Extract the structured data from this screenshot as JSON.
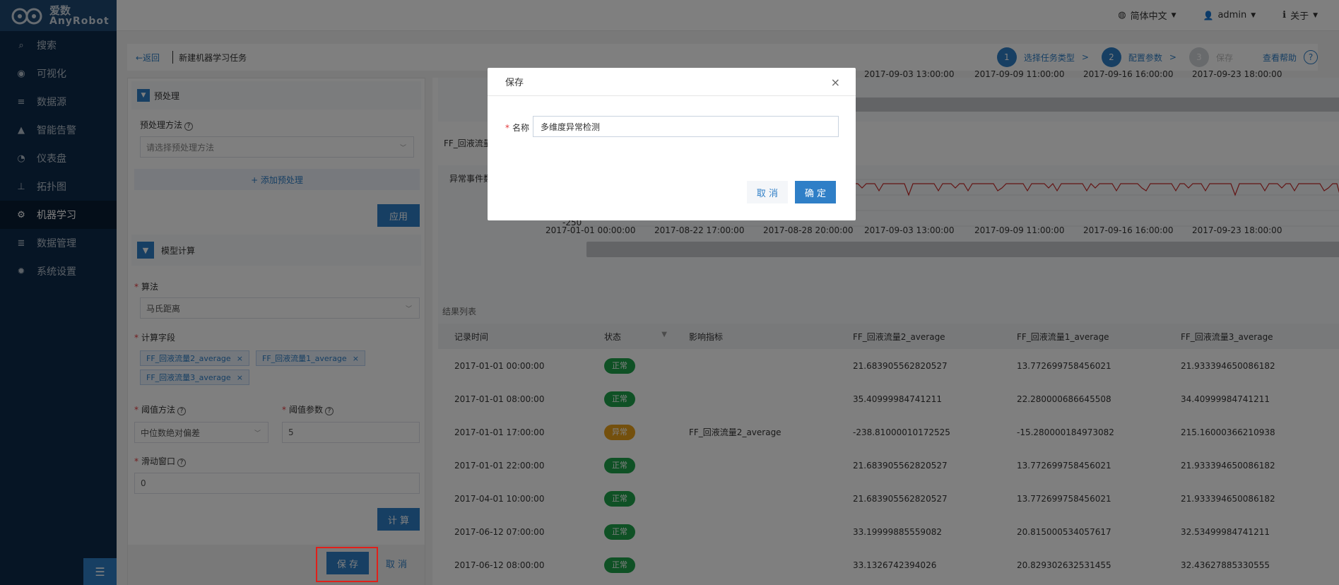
{
  "brand": {
    "name_cn": "爱数",
    "name_en": "AnyRobot"
  },
  "sidebar": {
    "items": [
      {
        "label": "搜索",
        "icon": "search-icon",
        "glyph": "⌕"
      },
      {
        "label": "可视化",
        "icon": "eye-icon",
        "glyph": "◉"
      },
      {
        "label": "数据源",
        "icon": "database-icon",
        "glyph": "≡"
      },
      {
        "label": "智能告警",
        "icon": "warning-icon",
        "glyph": "▲"
      },
      {
        "label": "仪表盘",
        "icon": "gauge-icon",
        "glyph": "◔"
      },
      {
        "label": "拓扑图",
        "icon": "topology-icon",
        "glyph": "⊥"
      },
      {
        "label": "机器学习",
        "icon": "ml-icon",
        "glyph": "⚙"
      },
      {
        "label": "数据管理",
        "icon": "data-mgmt-icon",
        "glyph": "≣"
      },
      {
        "label": "系统设置",
        "icon": "settings-icon",
        "glyph": "✹"
      }
    ],
    "active": "机器学习",
    "toggle_glyph": "☰"
  },
  "topbar": {
    "language": {
      "label": "简体中文",
      "icon": "globe-icon",
      "glyph": "◍"
    },
    "user": {
      "label": "admin",
      "icon": "user-icon",
      "glyph": "👤"
    },
    "about": {
      "label": "关于",
      "icon": "info-icon",
      "glyph": "ℹ"
    },
    "caret": "▼"
  },
  "header": {
    "back_label": "←返回",
    "title": "新建机器学习任务",
    "steps": [
      {
        "num": "1",
        "label": "选择任务类型",
        "state": "done"
      },
      {
        "num": "2",
        "label": "配置参数",
        "state": "current"
      },
      {
        "num": "3",
        "label": "保存",
        "state": "todo"
      }
    ],
    "arrow": ">",
    "help_label": "查看帮助",
    "help_glyph": "?"
  },
  "preprocess": {
    "section_title": "预处理",
    "method_label": "预处理方法",
    "method_placeholder": "请选择预处理方法",
    "add_label": "+ 添加预处理",
    "apply_label": "应用"
  },
  "model": {
    "section_title": "模型计算",
    "algorithm_label": "算法",
    "algorithm_value": "马氏距离",
    "fields_label": "计算字段",
    "fields": [
      "FF_回液流量2_average",
      "FF_回液流量1_average",
      "FF_回液流量3_average"
    ],
    "tag_close": "×",
    "threshold_method_label": "阈值方法",
    "threshold_method_value": "中位数绝对偏差",
    "threshold_param_label": "阈值参数",
    "threshold_param_value": "5",
    "window_label": "滑动窗口",
    "window_value": "0",
    "compute_label": "计 算",
    "save_label": "保 存",
    "cancel_label": "取 消"
  },
  "charts": {
    "top_axis_ticks": [
      "2017-09-03 13:00:00",
      "2017-09-09 11:00:00",
      "2017-09-16 16:00:00",
      "2017-09-23 18:00:00"
    ],
    "bottom_title": "FF_回液流量",
    "legend_label": "异常事件数",
    "y_tick": "-250",
    "bottom_axis_ticks": [
      "2017-01-01 00:00:00",
      "2017-08-22 17:00:00",
      "2017-08-28 20:00:00",
      "2017-09-03 13:00:00",
      "2017-09-09 11:00:00",
      "2017-09-16 16:00:00",
      "2017-09-23 18:00:00"
    ],
    "line_color": "#c62828"
  },
  "results": {
    "title": "结果列表",
    "columns": [
      "记录时间",
      "状态",
      "影响指标",
      "FF_回液流量2_average",
      "FF_回液流量1_average",
      "FF_回液流量3_average"
    ],
    "filter_glyph": "▼",
    "rows": [
      [
        "2017-01-01 00:00:00",
        "正常",
        "",
        "21.683905562820527",
        "13.772699758456021",
        "21.933394650086182"
      ],
      [
        "2017-01-01 08:00:00",
        "正常",
        "",
        "35.40999984741211",
        "22.280000686645508",
        "34.40999984741211"
      ],
      [
        "2017-01-01 17:00:00",
        "异常",
        "FF_回液流量2_average",
        "-238.81000010172525",
        "-15.280000184973082",
        "215.16000366210938"
      ],
      [
        "2017-01-01 22:00:00",
        "正常",
        "",
        "21.683905562820527",
        "13.772699758456021",
        "21.933394650086182"
      ],
      [
        "2017-04-01 10:00:00",
        "正常",
        "",
        "21.683905562820527",
        "13.772699758456021",
        "21.933394650086182"
      ],
      [
        "2017-06-12 07:00:00",
        "正常",
        "",
        "33.19999885559082",
        "20.815000534057617",
        "32.53499984741211"
      ],
      [
        "2017-06-12 08:00:00",
        "正常",
        "",
        "33.1326742394026",
        "20.829302632531455",
        "32.43627885330555"
      ]
    ]
  },
  "modal": {
    "title": "保存",
    "close_glyph": "×",
    "name_label": "名称",
    "name_value": "多维度异常检测",
    "cancel_label": "取 消",
    "ok_label": "确 定"
  },
  "colors": {
    "primary": "#2f7fc7",
    "sidebar": "#0d2a4b",
    "normal": "#1ea34a",
    "abnormal": "#e8a01a",
    "highlight": "#e0201a"
  }
}
